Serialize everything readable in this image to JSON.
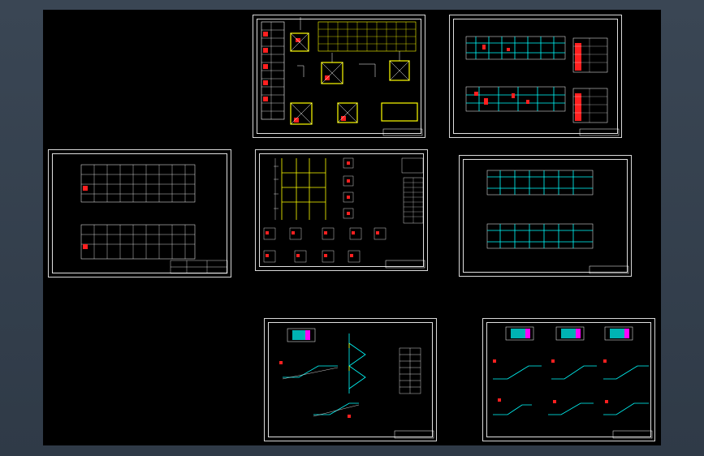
{
  "app": {
    "canvas_background": "#000000",
    "frame_color": "#34404d"
  },
  "colors": {
    "line": "#ffffff",
    "cyan": "#00ffff",
    "red": "#ff2020",
    "yellow": "#ffff00",
    "magenta": "#ff00ff",
    "green": "#00ff00"
  },
  "sheets": [
    {
      "name": "foundation-plan-sheet",
      "label": ""
    },
    {
      "name": "floor-plan-reinforcement-sheet",
      "label": ""
    },
    {
      "name": "frame-plan-sheet",
      "label": ""
    },
    {
      "name": "column-detail-sheet",
      "label": ""
    },
    {
      "name": "beam-layout-sheet",
      "label": ""
    },
    {
      "name": "stair-detail-sheet-a",
      "label": ""
    },
    {
      "name": "stair-detail-sheet-b",
      "label": ""
    }
  ]
}
